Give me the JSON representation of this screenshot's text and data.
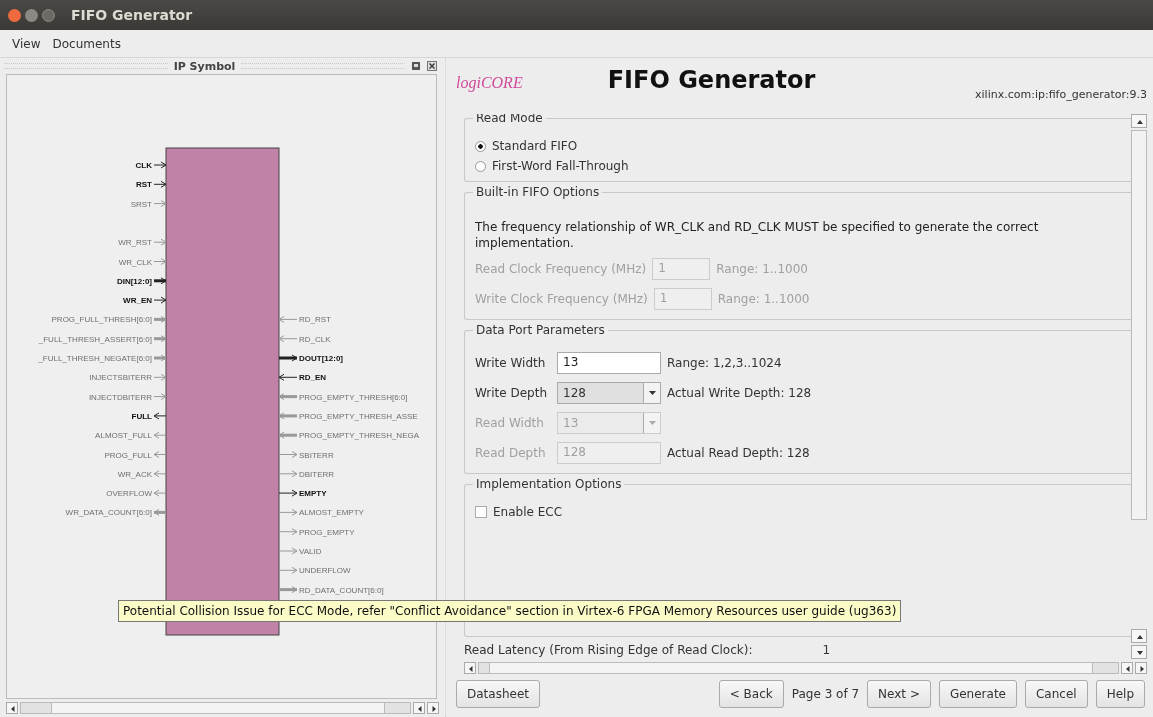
{
  "window": {
    "title": "FIFO Generator"
  },
  "menu": [
    {
      "label": "View"
    },
    {
      "label": "Documents"
    }
  ],
  "ip_symbol": {
    "title": "IP Symbol",
    "left_pin_groups": [
      [
        {
          "label": "CLK",
          "active": true,
          "bus": false,
          "kind": "input"
        },
        {
          "label": "RST",
          "active": true,
          "bus": false,
          "kind": "input"
        },
        {
          "label": "SRST",
          "active": false,
          "bus": false,
          "kind": "input"
        }
      ],
      [
        {
          "label": "WR_RST",
          "active": false,
          "bus": false,
          "kind": "input"
        },
        {
          "label": "WR_CLK",
          "active": false,
          "bus": false,
          "kind": "input"
        },
        {
          "label": "DIN[12:0]",
          "active": true,
          "bus": true,
          "kind": "input"
        },
        {
          "label": "WR_EN",
          "active": true,
          "bus": false,
          "kind": "input"
        },
        {
          "label": "PROG_FULL_THRESH[6:0]",
          "active": false,
          "bus": true,
          "kind": "input"
        },
        {
          "label": "_FULL_THRESH_ASSERT[6:0]",
          "active": false,
          "bus": true,
          "kind": "input"
        },
        {
          "label": "_FULL_THRESH_NEGATE[6:0]",
          "active": false,
          "bus": true,
          "kind": "input"
        },
        {
          "label": "INJECTSBITERR",
          "active": false,
          "bus": false,
          "kind": "input"
        },
        {
          "label": "INJECTDBITERR",
          "active": false,
          "bus": false,
          "kind": "input"
        },
        {
          "label": "FULL",
          "active": true,
          "bus": false,
          "kind": "output"
        },
        {
          "label": "ALMOST_FULL",
          "active": false,
          "bus": false,
          "kind": "output"
        },
        {
          "label": "PROG_FULL",
          "active": false,
          "bus": false,
          "kind": "output"
        },
        {
          "label": "WR_ACK",
          "active": false,
          "bus": false,
          "kind": "output"
        },
        {
          "label": "OVERFLOW",
          "active": false,
          "bus": false,
          "kind": "output"
        },
        {
          "label": "WR_DATA_COUNT[6:0]",
          "active": false,
          "bus": true,
          "kind": "output"
        }
      ]
    ],
    "right_pins": [
      {
        "label": "RD_RST",
        "active": false,
        "bus": false,
        "kind": "input"
      },
      {
        "label": "RD_CLK",
        "active": false,
        "bus": false,
        "kind": "input"
      },
      {
        "label": "DOUT[12:0]",
        "active": true,
        "bus": true,
        "kind": "output"
      },
      {
        "label": "RD_EN",
        "active": true,
        "bus": false,
        "kind": "input"
      },
      {
        "label": "PROG_EMPTY_THRESH[6:0]",
        "active": false,
        "bus": true,
        "kind": "input"
      },
      {
        "label": "PROG_EMPTY_THRESH_ASSE",
        "active": false,
        "bus": true,
        "kind": "input"
      },
      {
        "label": "PROG_EMPTY_THRESH_NEGA",
        "active": false,
        "bus": true,
        "kind": "input"
      },
      {
        "label": "SBITERR",
        "active": false,
        "bus": false,
        "kind": "output"
      },
      {
        "label": "DBITERR",
        "active": false,
        "bus": false,
        "kind": "output"
      },
      {
        "label": "EMPTY",
        "active": true,
        "bus": false,
        "kind": "output"
      },
      {
        "label": "ALMOST_EMPTY",
        "active": false,
        "bus": false,
        "kind": "output"
      },
      {
        "label": "PROG_EMPTY",
        "active": false,
        "bus": false,
        "kind": "output"
      },
      {
        "label": "VALID",
        "active": false,
        "bus": false,
        "kind": "output"
      },
      {
        "label": "UNDERFLOW",
        "active": false,
        "bus": false,
        "kind": "output"
      },
      {
        "label": "RD_DATA_COUNT[6:0]",
        "active": false,
        "bus": true,
        "kind": "output"
      }
    ]
  },
  "header": {
    "logo": "logiCORE",
    "title": "FIFO Generator",
    "ip_id": "xilinx.com:ip:fifo_generator:9.3"
  },
  "read_mode": {
    "title": "Read Mode",
    "options": [
      {
        "label": "Standard FIFO",
        "selected": true
      },
      {
        "label": "First-Word Fall-Through",
        "selected": false
      }
    ]
  },
  "builtin_options": {
    "title": "Built-in FIFO Options",
    "note": "The frequency relationship of WR_CLK and RD_CLK MUST be specified to generate the correct implementation.",
    "fields": [
      {
        "label": "Read Clock Frequency (MHz)",
        "value": "1",
        "range": "Range: 1..1000",
        "disabled": true
      },
      {
        "label": "Write Clock Frequency (MHz)",
        "value": "1",
        "range": "Range: 1..1000",
        "disabled": true
      }
    ]
  },
  "data_port": {
    "title": "Data Port Parameters",
    "rows": [
      {
        "label": "Write Width",
        "kind": "input",
        "value": "13",
        "note": "Range: 1,2,3..1024",
        "disabled": false
      },
      {
        "label": "Write Depth",
        "kind": "select",
        "value": "128",
        "note": "Actual Write Depth:  128",
        "disabled": false
      },
      {
        "label": "Read Width",
        "kind": "select",
        "value": "13",
        "disabled": true
      },
      {
        "label": "Read Depth",
        "kind": "input",
        "value": "128",
        "note": "Actual Read Depth:  128",
        "disabled": true
      }
    ]
  },
  "implementation": {
    "title": "Implementation Options",
    "options": [
      {
        "label": "Enable ECC",
        "checked": false
      }
    ]
  },
  "read_latency": {
    "label": "Read Latency (From Rising Edge of Read Clock):",
    "value": "1"
  },
  "tooltip": "Potential Collision Issue for ECC Mode, refer \"Conflict Avoidance\" section in Virtex-6 FPGA Memory Resources user guide (ug363)",
  "footer": {
    "datasheet": "Datasheet",
    "back": "< Back",
    "page": "Page 3 of 7",
    "next": "Next >",
    "generate": "Generate",
    "cancel": "Cancel",
    "help": "Help"
  }
}
